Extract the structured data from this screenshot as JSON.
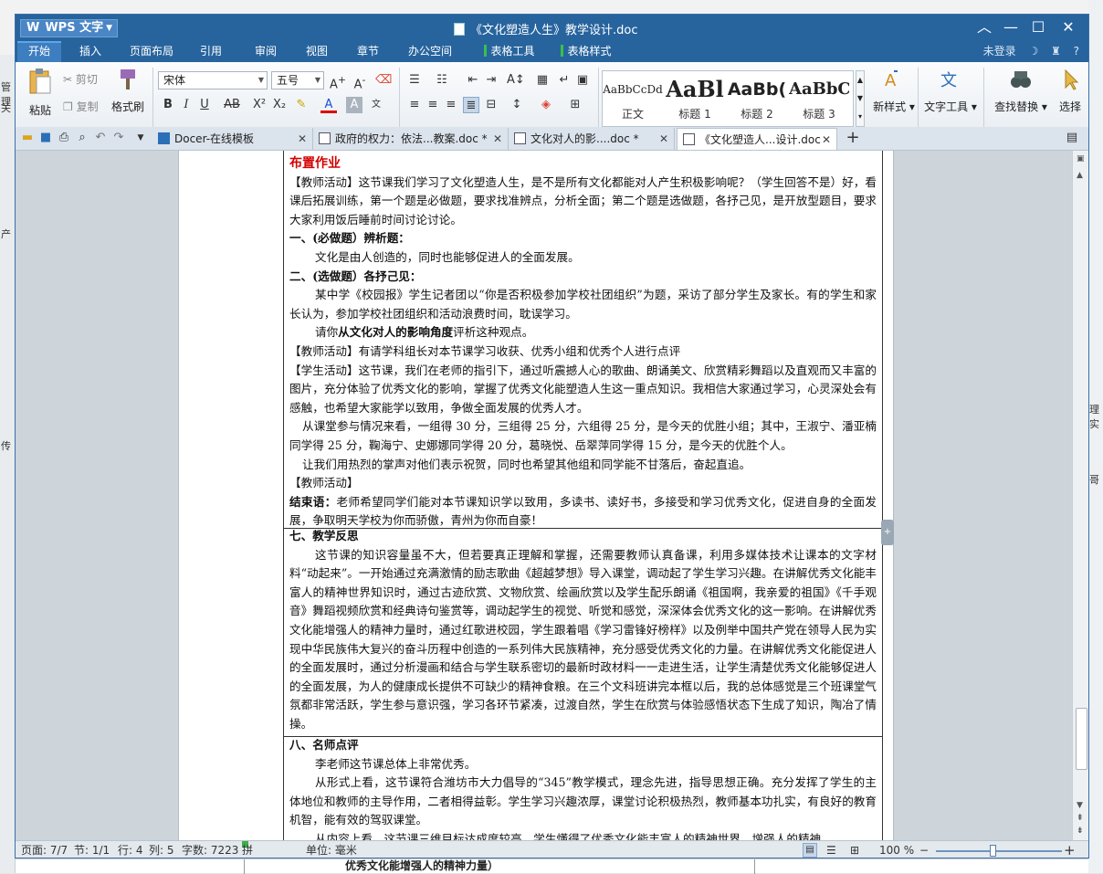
{
  "background_window": {
    "left_fragments": [
      "管理",
      "关",
      "产",
      "传"
    ],
    "right_fragments": [
      "理实",
      "哥"
    ],
    "bottom_text": "优秀文化能增强人的精神力量）"
  },
  "title_bar": {
    "app_button": "WPS 文字",
    "title": "《文化塑造人生》教学设计.doc"
  },
  "menu": {
    "tabs": [
      "开始",
      "插入",
      "页面布局",
      "引用",
      "审阅",
      "视图",
      "章节",
      "办公空间"
    ],
    "context_tabs": [
      "表格工具",
      "表格样式"
    ],
    "login": "未登录",
    "help": "?"
  },
  "ribbon": {
    "paste": "粘贴",
    "cut": "剪切",
    "copy": "复制",
    "format_painter": "格式刷",
    "font_name": "宋体",
    "font_size": "五号",
    "styles": [
      {
        "preview": "AaBbCcDd",
        "name": "正文"
      },
      {
        "preview": "AaBl",
        "name": "标题 1"
      },
      {
        "preview": "AaBb(",
        "name": "标题 2"
      },
      {
        "preview": "AaBbC",
        "name": "标题 3"
      }
    ],
    "new_style": "新样式",
    "text_tools": "文字工具",
    "find_replace": "查找替换",
    "select": "选择"
  },
  "doc_tabs": [
    {
      "label": "Docer-在线模板",
      "active": false
    },
    {
      "label": "政府的权力：依法...教案.doc *",
      "active": false
    },
    {
      "label": "文化对人的影....doc *",
      "active": false
    },
    {
      "label": "《文化塑造人...设计.doc",
      "active": true
    }
  ],
  "document": {
    "s1_title": "布置作业",
    "s1_p1": "【教师活动】这节课我们学习了文化塑造人生，是不是所有文化都能对人产生积极影响呢？（学生回答不是）好，看课后拓展训练，第一个题是必做题，要求找准辨点，分析全面；第二个题是选做题，各抒己见，是开放型题目，要求大家利用饭后睡前时间讨论讨论。",
    "s1_q1_title": "一、(必做题）辨析题：",
    "s1_q1_body": "文化是由人创造的，同时也能够促进人的全面发展。",
    "s1_q2_title": "二、(选做题）各抒己见：",
    "s1_q2_body": "某中学《校园报》学生记者团以“你是否积极参加学校社团组织”为题，采访了部分学生及家长。有的学生和家长认为，参加学校社团组织和活动浪费时间，耽误学习。",
    "s1_q2_ask_a": "请你",
    "s1_q2_ask_b": "从文化对人的影响角度",
    "s1_q2_ask_c": "评析这种观点。",
    "s1_p2": "【教师活动】有请学科组长对本节课学习收获、优秀小组和优秀个人进行点评",
    "s1_p3": "【学生活动】这节课，我们在老师的指引下，通过听震撼人心的歌曲、朗诵美文、欣赏精彩舞蹈以及直观而又丰富的图片，充分体验了优秀文化的影响，掌握了优秀文化能塑造人生这一重点知识。我相信大家通过学习，心灵深处会有感触，也希望大家能学以致用，争做全面发展的优秀人才。",
    "s1_p4": "从课堂参与情况来看，一组得 30 分，三组得 25 分，六组得 25 分，是今天的优胜小组；其中，王淑宁、潘亚楠同学得 25 分，鞠海宁、史娜娜同学得 20 分，葛晓悦、岳翠萍同学得 15 分，是今天的优胜个人。",
    "s1_p5": "让我们用热烈的掌声对他们表示祝贺，同时也希望其他组和同学能不甘落后，奋起直追。",
    "s1_p6": "【教师活动】",
    "s1_end_label": "结束语：",
    "s1_end_body": "老师希望同学们能对本节课知识学以致用，多读书、读好书，多接受和学习优秀文化，促进自身的全面发展，争取明天学校为你而骄傲，青州为你而自豪！",
    "s7_title": "七、教学反思",
    "s7_body": "这节课的知识容量虽不大，但若要真正理解和掌握，还需要教师认真备课，利用多媒体技术让课本的文字材料“动起来”。一开始通过充满激情的励志歌曲《超越梦想》导入课堂，调动起了学生学习兴趣。在讲解优秀文化能丰富人的精神世界知识时，通过古迹欣赏、文物欣赏、绘画欣赏以及学生配乐朗诵《祖国啊，我亲爱的祖国》《千手观音》舞蹈视频欣赏和经典诗句鉴赏等，调动起学生的视觉、听觉和感觉，深深体会优秀文化的这一影响。在讲解优秀文化能增强人的精神力量时，通过红歌进校园，学生跟着唱《学习雷锋好榜样》以及例举中国共产党在领导人民为实现中华民族伟大复兴的奋斗历程中创造的一系列伟大民族精神，充分感受优秀文化的力量。在讲解优秀文化能促进人的全面发展时，通过分析漫画和结合与学生联系密切的最新时政材料一一走进生活，让学生清楚优秀文化能够促进人的全面发展，为人的健康成长提供不可缺少的精神食粮。在三个文科班讲完本框以后，我的总体感觉是三个班课堂气氛都非常活跃，学生参与意识强，学习各环节紧凑，过渡自然，学生在欣赏与体验感悟状态下生成了知识，陶冶了情操。",
    "s8_title": "八、名师点评",
    "s8_p1": "李老师这节课总体上非常优秀。",
    "s8_p2": "从形式上看，这节课符合潍坊市大力倡导的“345”教学模式，理念先进，指导思想正确。充分发挥了学生的主体地位和教师的主导作用，二者相得益彰。学生学习兴趣浓厚，课堂讨论积极热烈，教师基本功扎实，有良好的教育机智，能有效的驾驭课堂。",
    "s8_p3": "从内容上看，这节课三维目标达成度较高，学生懂得了优秀文化能丰富人的精神世界、增强人的精神"
  },
  "status": {
    "page": "页面: 7/7",
    "section": "节: 1/1",
    "row": "行: 4",
    "col": "列: 5",
    "words": "字数: 7223",
    "spell": "拼写检查",
    "unit": "单位: 毫米",
    "zoom": "100 %",
    "zoom_level": 0.45
  }
}
